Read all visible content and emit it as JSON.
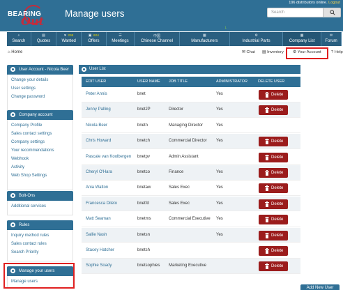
{
  "header": {
    "logo_text": "BEARING",
    "logo_script": "Out",
    "page_title": "Manage users",
    "online_text": "196 distributors online.",
    "logout": "Logout",
    "search_placeholder": "Search"
  },
  "nav": [
    {
      "label": "Search",
      "icon": "search-icon",
      "glyph": "⌕",
      "badge": ""
    },
    {
      "label": "Quotes",
      "icon": "quotes-icon",
      "glyph": "▤",
      "badge": ""
    },
    {
      "label": "Wanted",
      "icon": "wanted-icon",
      "glyph": "♥",
      "badge": "298"
    },
    {
      "label": "Offers",
      "icon": "offers-icon",
      "glyph": "▣",
      "badge": "604"
    },
    {
      "label": "Meetings",
      "icon": "meetings-icon",
      "glyph": "☰",
      "badge": ""
    },
    {
      "label": "Chinese Channel",
      "icon": "chinese-channel-icon",
      "glyph": "中国",
      "badge": ""
    },
    {
      "label": "Manufacturers",
      "icon": "manufacturers-icon",
      "glyph": "▦",
      "badge": "1"
    },
    {
      "label": "Industrial Parts",
      "icon": "industrial-parts-icon",
      "glyph": "⚙",
      "badge": ""
    },
    {
      "label": "Company List",
      "icon": "company-list-icon",
      "glyph": "▦",
      "badge": ""
    },
    {
      "label": "Forum",
      "icon": "forum-icon",
      "glyph": "✉",
      "badge": ""
    }
  ],
  "breadcrumb": {
    "home": "Home"
  },
  "utility": {
    "chat": "Chat",
    "inventory": "Inventory",
    "your_account": "Your Account",
    "help": "Help"
  },
  "sidebar": {
    "user_account": {
      "title": "User Account - Nicola Beer",
      "links": [
        "Change your details",
        "User settings",
        "Change password"
      ]
    },
    "company_account": {
      "title": "Company account",
      "links": [
        "Company Profile",
        "Sales contact settings",
        "Company settings",
        "Your recommendations",
        "Webhook",
        "Activity",
        "Web Shop Settings"
      ]
    },
    "bolt_ons": {
      "title": "Bolt-Ons",
      "links": [
        "Additional services"
      ]
    },
    "rules": {
      "title": "Rules",
      "links": [
        "Inquiry method rules",
        "Sales contact rules",
        "Search Priority"
      ]
    },
    "manage_users": {
      "title": "Manage your users",
      "links": [
        "Manage users"
      ]
    }
  },
  "user_list": {
    "title": "User List",
    "columns": {
      "edit_user": "EDIT USER",
      "user_name": "USER NAME",
      "job_title": "JOB TITLE",
      "administrator": "ADMINISTRATOR",
      "delete_user": "DELETE USER"
    },
    "delete_label": "Delete",
    "add_label": "Add New User",
    "rows": [
      {
        "name": "Peter Annis",
        "username": "bnet",
        "job": "",
        "admin": "Yes",
        "deletable": true
      },
      {
        "name": "Jenny Palling",
        "username": "bnetJP",
        "job": "Director",
        "admin": "Yes",
        "deletable": true
      },
      {
        "name": "Nicola Beer",
        "username": "bnetn",
        "job": "Managing Director",
        "admin": "Yes",
        "deletable": false
      },
      {
        "name": "Chris Howard",
        "username": "bnetch",
        "job": "Commercial Director",
        "admin": "Yes",
        "deletable": true
      },
      {
        "name": "Pascale van Koolbergen",
        "username": "bnetpv",
        "job": "Admin Assistant",
        "admin": "",
        "deletable": true
      },
      {
        "name": "Cheryl O'Hara",
        "username": "bnetco",
        "job": "Finance",
        "admin": "Yes",
        "deletable": true
      },
      {
        "name": "Ania Walton",
        "username": "bnetaw",
        "job": "Sales Exec",
        "admin": "Yes",
        "deletable": true
      },
      {
        "name": "Francesca Dileto",
        "username": "bnetfd",
        "job": "Sales Exec",
        "admin": "Yes",
        "deletable": true
      },
      {
        "name": "Matt Seaman",
        "username": "bnetms",
        "job": "Commercial Executive",
        "admin": "Yes",
        "deletable": true
      },
      {
        "name": "Sallie Nash",
        "username": "bnetsn",
        "job": "",
        "admin": "Yes",
        "deletable": true
      },
      {
        "name": "Stacey Hatcher",
        "username": "bnetsh",
        "job": "",
        "admin": "",
        "deletable": true
      },
      {
        "name": "Sophie Soady",
        "username": "bnetsophies",
        "job": "Marketing Executive",
        "admin": "",
        "deletable": true
      }
    ]
  },
  "colors": {
    "primary": "#2f6f95",
    "nav": "#2a5f80",
    "delete": "#9b1c1c",
    "highlight": "#e02020"
  }
}
